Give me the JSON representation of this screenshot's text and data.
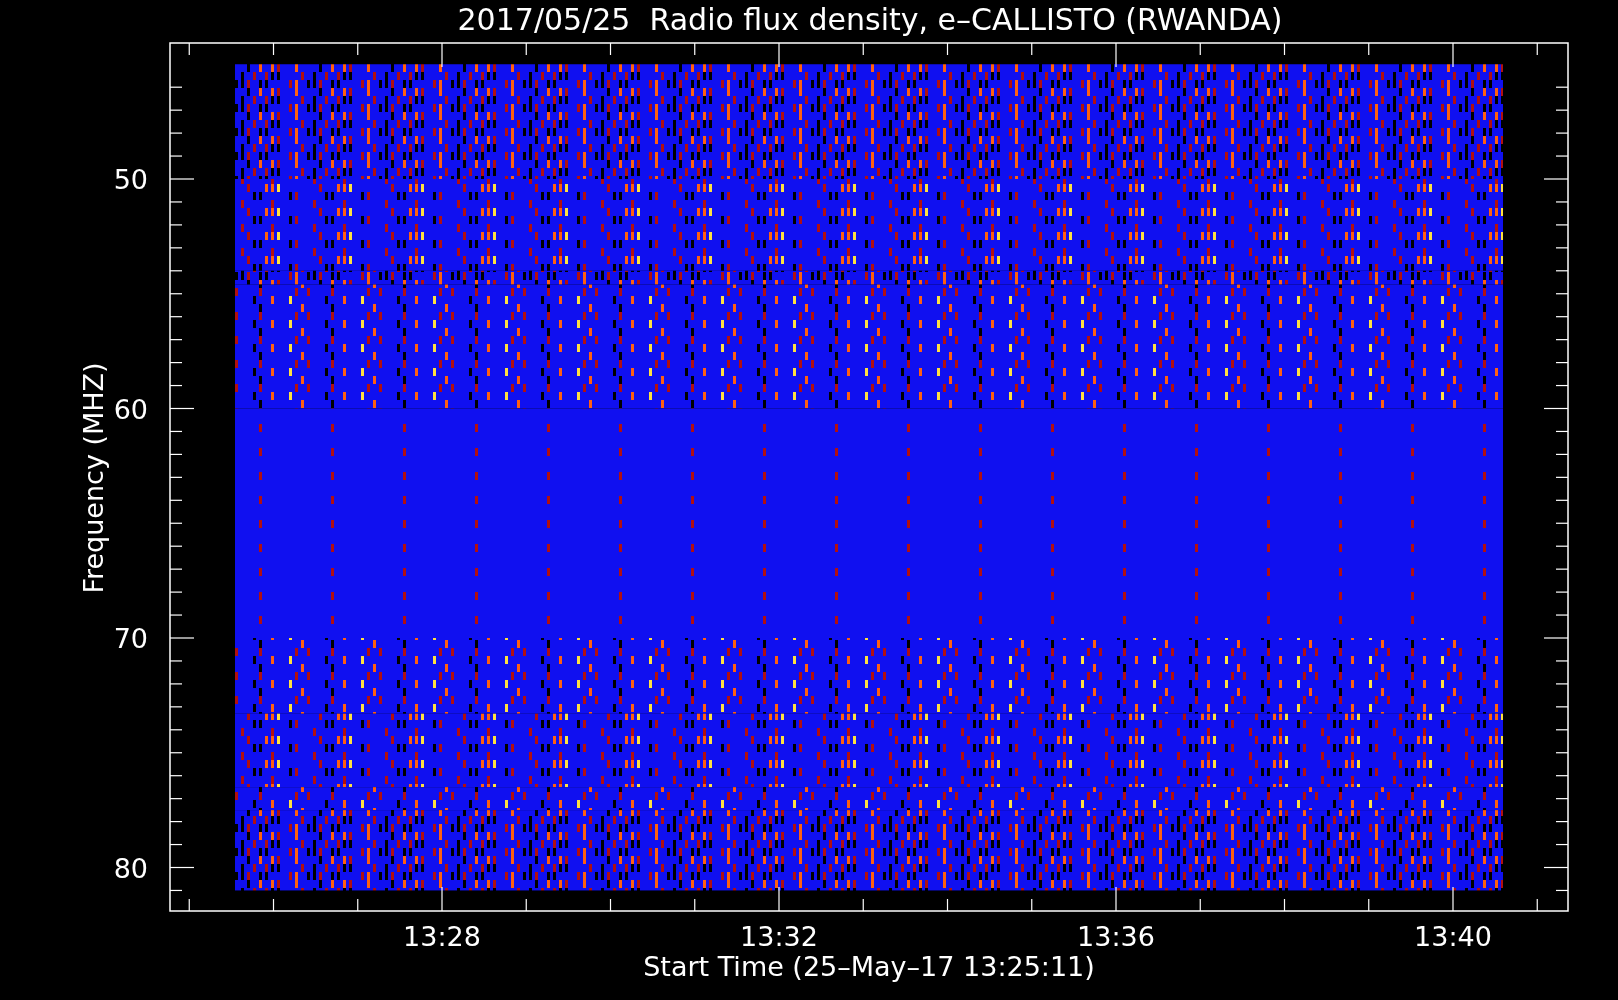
{
  "title": "2017/05/25  Radio flux density, e–CALLISTO (RWANDA)",
  "x_axis": {
    "label": "Start Time (25–May–17 13:25:11)",
    "ticks": [
      "13:28",
      "13:32",
      "13:36",
      "13:40"
    ]
  },
  "y_axis": {
    "label": "Frequency (MHZ)",
    "ticks": [
      "50",
      "60",
      "70",
      "80"
    ]
  }
}
